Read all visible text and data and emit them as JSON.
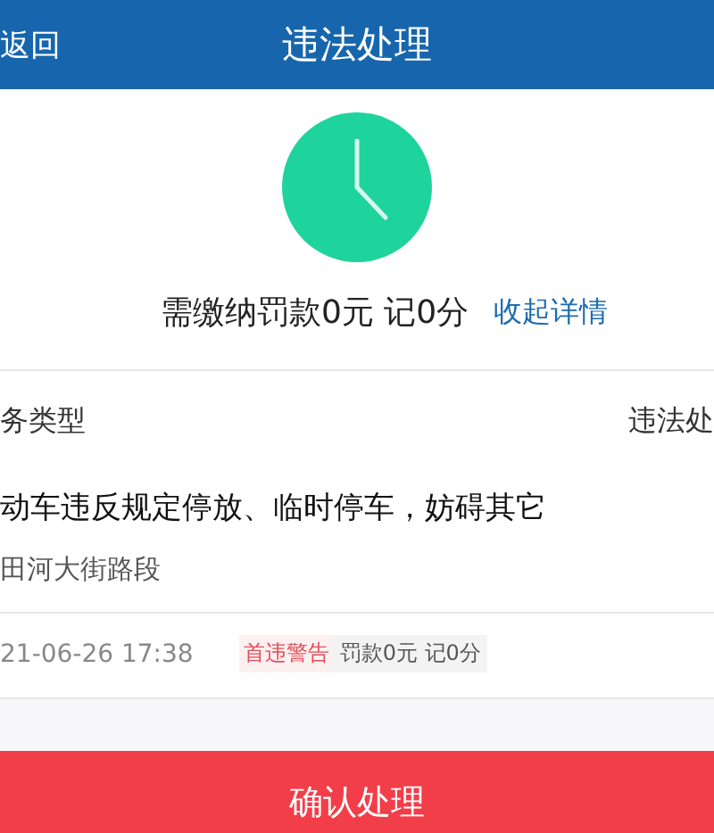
{
  "header": {
    "back": "返回",
    "title": "违法处理"
  },
  "summary": {
    "text": "需缴纳罚款0元 记0分",
    "toggle": "收起详情"
  },
  "info_row": {
    "label": "务类型",
    "value": "违法处"
  },
  "record": {
    "violation": "动车违反规定停放、临时停车，妨碍其它",
    "location": "田河大街路段",
    "time": "21-06-26 17:38",
    "tag": "首违警告",
    "penalty": "罚款0元 记0分"
  },
  "confirm_button": "确认处理"
}
